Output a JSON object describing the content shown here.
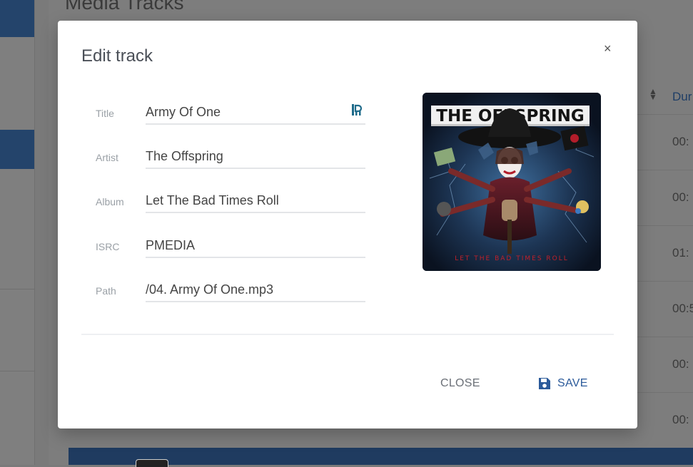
{
  "background": {
    "page_title": "Media Tracks",
    "duration_header": "Dur",
    "durations": [
      "00:",
      "00:",
      "01:",
      "00:5",
      "00:",
      "00:"
    ]
  },
  "dialog": {
    "title": "Edit track",
    "close_icon": "close-icon",
    "fields": [
      {
        "label": "Title",
        "value": "Army Of One"
      },
      {
        "label": "Artist",
        "value": "The Offspring"
      },
      {
        "label": "Album",
        "value": "Let The Bad Times Roll"
      },
      {
        "label": "ISRC",
        "value": "PMEDIA"
      },
      {
        "label": "Path",
        "value": "/04. Army Of One.mp3"
      }
    ],
    "cover": {
      "band": "THE OFFSPRING",
      "album": "LET THE BAD TIMES ROLL"
    },
    "buttons": {
      "close": "CLOSE",
      "save": "SAVE"
    }
  },
  "colors": {
    "accent": "#2b5a9a",
    "sidebar_active": "#24446b"
  }
}
